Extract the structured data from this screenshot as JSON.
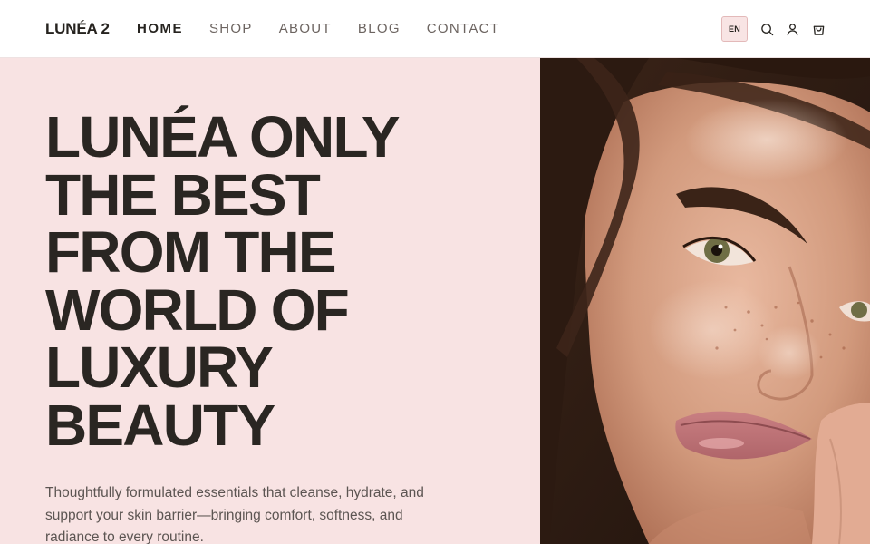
{
  "header": {
    "logo": "LUNÉA 2",
    "nav": [
      {
        "label": "HOME",
        "active": true
      },
      {
        "label": "SHOP",
        "active": false
      },
      {
        "label": "ABOUT",
        "active": false
      },
      {
        "label": "BLOG",
        "active": false
      },
      {
        "label": "CONTACT",
        "active": false
      }
    ],
    "language": "EN",
    "icons": [
      "search-icon",
      "user-icon",
      "cart-icon"
    ]
  },
  "hero": {
    "headline_lines": [
      "LUNÉA ONLY",
      "THE BEST",
      "FROM THE",
      "WORLD OF",
      "LUXURY",
      "BEAUTY"
    ],
    "description": "Thoughtfully formulated essentials that cleanse, hydrate, and support your skin barrier—bringing comfort, softness, and radiance to every routine.",
    "image": "portrait-photo"
  },
  "colors": {
    "hero_background": "#f8e3e3",
    "text_dark": "#2a2622",
    "text_muted": "#5c5552",
    "language_badge_bg": "#f8e4e4"
  }
}
